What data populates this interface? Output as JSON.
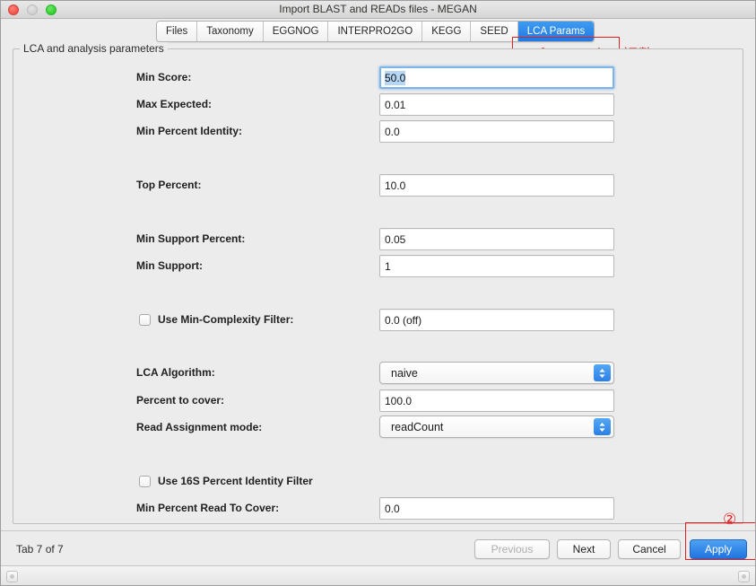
{
  "window": {
    "title": "Import BLAST and READs files - MEGAN",
    "controls": [
      "close",
      "minimize",
      "maximize"
    ]
  },
  "tabs": [
    {
      "label": "Files",
      "active": false
    },
    {
      "label": "Taxonomy",
      "active": false
    },
    {
      "label": "EGGNOG",
      "active": false
    },
    {
      "label": "INTERPRO2GO",
      "active": false
    },
    {
      "label": "KEGG",
      "active": false
    },
    {
      "label": "SEED",
      "active": false
    },
    {
      "label": "LCA Params",
      "active": true
    }
  ],
  "annotations": [
    {
      "id": "annot-1",
      "text": "① LCAパラメータの調整",
      "color": "#e02020"
    },
    {
      "id": "annot-2",
      "text": "②",
      "color": "#e02020"
    }
  ],
  "group": {
    "title": "LCA and analysis parameters"
  },
  "fields": {
    "min_score": {
      "label": "Min Score:",
      "value": "50.0",
      "focused": true,
      "selected": true
    },
    "max_expected": {
      "label": "Max Expected:",
      "value": "0.01",
      "focused": false,
      "selected": false
    },
    "min_percent_identity": {
      "label": "Min Percent Identity:",
      "value": "0.0",
      "focused": false,
      "selected": false
    },
    "top_percent": {
      "label": "Top Percent:",
      "value": "10.0",
      "focused": false,
      "selected": false
    },
    "min_support_percent": {
      "label": "Min Support Percent:",
      "value": "0.05",
      "focused": false,
      "selected": false
    },
    "min_support": {
      "label": "Min Support:",
      "value": "1",
      "focused": false,
      "selected": false
    },
    "min_complexity": {
      "label": "Use Min-Complexity Filter:",
      "value": "0.0 (off)",
      "checked": false
    },
    "lca_algorithm": {
      "label": "LCA Algorithm:",
      "value": "naive"
    },
    "percent_to_cover": {
      "label": "Percent to cover:",
      "value": "100.0",
      "focused": false,
      "selected": false
    },
    "read_assignment_mode": {
      "label": "Read Assignment mode:",
      "value": "readCount"
    },
    "use_16s_filter": {
      "label": "Use 16S Percent Identity Filter",
      "checked": false
    },
    "min_percent_read_to_cover": {
      "label": "Min Percent Read To Cover:",
      "value": "0.0",
      "focused": false,
      "selected": false
    }
  },
  "footer": {
    "tab_count": "Tab 7 of 7",
    "buttons": {
      "previous": {
        "label": "Previous",
        "enabled": false,
        "primary": false
      },
      "next": {
        "label": "Next",
        "enabled": true,
        "primary": false
      },
      "cancel": {
        "label": "Cancel",
        "enabled": true,
        "primary": false
      },
      "apply": {
        "label": "Apply",
        "enabled": true,
        "primary": true
      }
    }
  },
  "colors": {
    "accent_blue": "#2079e4",
    "annotation_red": "#e02020",
    "window_bg": "#ececec",
    "field_bg": "#ffffff"
  }
}
